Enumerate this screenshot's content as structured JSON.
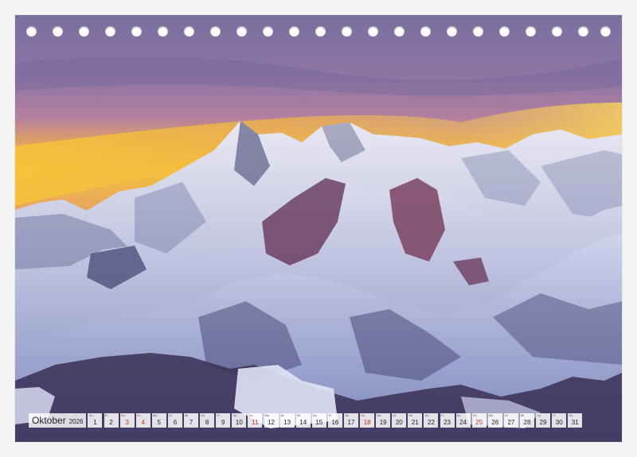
{
  "calendar": {
    "month": "Oktober",
    "year": "2026",
    "weekend_color": "#c0322b",
    "days": [
      {
        "dow": "Do",
        "num": "1",
        "weekend": false
      },
      {
        "dow": "Fr",
        "num": "2",
        "weekend": false
      },
      {
        "dow": "Sa",
        "num": "3",
        "weekend": true
      },
      {
        "dow": "So",
        "num": "4",
        "weekend": true
      },
      {
        "dow": "Mo",
        "num": "5",
        "weekend": false
      },
      {
        "dow": "Di",
        "num": "6",
        "weekend": false
      },
      {
        "dow": "Mi",
        "num": "7",
        "weekend": false
      },
      {
        "dow": "Do",
        "num": "8",
        "weekend": false
      },
      {
        "dow": "Fr",
        "num": "9",
        "weekend": false
      },
      {
        "dow": "Sa",
        "num": "10",
        "weekend": false
      },
      {
        "dow": "So",
        "num": "11",
        "weekend": true
      },
      {
        "dow": "Mo",
        "num": "12",
        "weekend": false
      },
      {
        "dow": "Di",
        "num": "13",
        "weekend": false
      },
      {
        "dow": "Mi",
        "num": "14",
        "weekend": false
      },
      {
        "dow": "Do",
        "num": "15",
        "weekend": false
      },
      {
        "dow": "Fr",
        "num": "16",
        "weekend": false
      },
      {
        "dow": "Sa",
        "num": "17",
        "weekend": false
      },
      {
        "dow": "So",
        "num": "18",
        "weekend": true
      },
      {
        "dow": "Mo",
        "num": "19",
        "weekend": false
      },
      {
        "dow": "Di",
        "num": "20",
        "weekend": false
      },
      {
        "dow": "Mi",
        "num": "21",
        "weekend": false
      },
      {
        "dow": "Do",
        "num": "22",
        "weekend": false
      },
      {
        "dow": "Fr",
        "num": "23",
        "weekend": false
      },
      {
        "dow": "Sa",
        "num": "24",
        "weekend": false
      },
      {
        "dow": "So",
        "num": "25",
        "weekend": true
      },
      {
        "dow": "Mo",
        "num": "26",
        "weekend": false
      },
      {
        "dow": "Di",
        "num": "27",
        "weekend": false
      },
      {
        "dow": "Mi",
        "num": "28",
        "weekend": false
      },
      {
        "dow": "Do",
        "num": "29",
        "weekend": false
      },
      {
        "dow": "Fr",
        "num": "30",
        "weekend": false
      },
      {
        "dow": "Sa",
        "num": "31",
        "weekend": false
      }
    ]
  },
  "photo": {
    "subject": "snow-mountains-sunset-image",
    "sky_colors": [
      "#7a6f9e",
      "#b47f9f",
      "#f3c33a"
    ],
    "snow_color": "#e8ecf7",
    "rock_color": "#6b3f63"
  }
}
